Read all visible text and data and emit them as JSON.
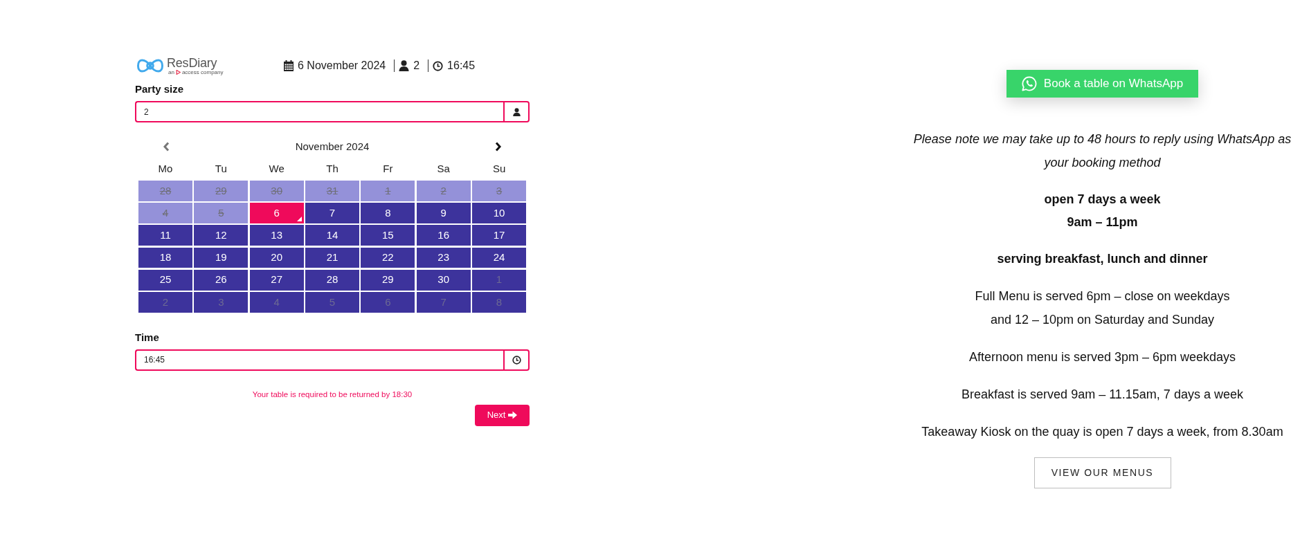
{
  "booking_widget": {
    "logo": {
      "wordmark": "ResDiary",
      "tagline_lead": "an",
      "tagline_rest": "access company"
    },
    "summary": {
      "date": "6 November 2024",
      "party_size": "2",
      "time": "16:45"
    },
    "party_size": {
      "label": "Party size",
      "value": "2"
    },
    "calendar": {
      "title": "November 2024",
      "prev": {
        "disabled": true
      },
      "next": {
        "disabled": false
      },
      "weekdays": [
        "Mo",
        "Tu",
        "We",
        "Th",
        "Fr",
        "Sa",
        "Su"
      ],
      "weeks": [
        {
          "days": [
            {
              "day": "28",
              "kind": "past",
              "selected": false
            },
            {
              "day": "29",
              "kind": "past",
              "selected": false
            },
            {
              "day": "30",
              "kind": "past",
              "selected": false
            },
            {
              "day": "31",
              "kind": "past",
              "selected": false
            },
            {
              "day": "1",
              "kind": "past",
              "selected": false
            },
            {
              "day": "2",
              "kind": "past",
              "selected": false
            },
            {
              "day": "3",
              "kind": "past",
              "selected": false
            }
          ]
        },
        {
          "days": [
            {
              "day": "4",
              "kind": "past",
              "selected": false
            },
            {
              "day": "5",
              "kind": "past",
              "selected": false
            },
            {
              "day": "6",
              "kind": "open",
              "selected": true
            },
            {
              "day": "7",
              "kind": "open",
              "selected": false
            },
            {
              "day": "8",
              "kind": "open",
              "selected": false
            },
            {
              "day": "9",
              "kind": "open",
              "selected": false
            },
            {
              "day": "10",
              "kind": "open",
              "selected": false
            }
          ]
        },
        {
          "days": [
            {
              "day": "11",
              "kind": "open",
              "selected": false
            },
            {
              "day": "12",
              "kind": "open",
              "selected": false
            },
            {
              "day": "13",
              "kind": "open",
              "selected": false
            },
            {
              "day": "14",
              "kind": "open",
              "selected": false
            },
            {
              "day": "15",
              "kind": "open",
              "selected": false
            },
            {
              "day": "16",
              "kind": "open",
              "selected": false
            },
            {
              "day": "17",
              "kind": "open",
              "selected": false
            }
          ]
        },
        {
          "days": [
            {
              "day": "18",
              "kind": "open",
              "selected": false
            },
            {
              "day": "19",
              "kind": "open",
              "selected": false
            },
            {
              "day": "20",
              "kind": "open",
              "selected": false
            },
            {
              "day": "21",
              "kind": "open",
              "selected": false
            },
            {
              "day": "22",
              "kind": "open",
              "selected": false
            },
            {
              "day": "23",
              "kind": "open",
              "selected": false
            },
            {
              "day": "24",
              "kind": "open",
              "selected": false
            }
          ]
        },
        {
          "days": [
            {
              "day": "25",
              "kind": "open",
              "selected": false
            },
            {
              "day": "26",
              "kind": "open",
              "selected": false
            },
            {
              "day": "27",
              "kind": "open",
              "selected": false
            },
            {
              "day": "28",
              "kind": "open",
              "selected": false
            },
            {
              "day": "29",
              "kind": "open",
              "selected": false
            },
            {
              "day": "30",
              "kind": "open",
              "selected": false
            },
            {
              "day": "1",
              "kind": "outside",
              "selected": false
            }
          ]
        },
        {
          "days": [
            {
              "day": "2",
              "kind": "outside",
              "selected": false
            },
            {
              "day": "3",
              "kind": "outside",
              "selected": false
            },
            {
              "day": "4",
              "kind": "outside",
              "selected": false
            },
            {
              "day": "5",
              "kind": "outside",
              "selected": false
            },
            {
              "day": "6",
              "kind": "outside",
              "selected": false
            },
            {
              "day": "7",
              "kind": "outside",
              "selected": false
            },
            {
              "day": "8",
              "kind": "outside",
              "selected": false
            }
          ]
        }
      ]
    },
    "time": {
      "label": "Time",
      "value": "16:45"
    },
    "notice": "Your table is required to be returned by 18:30",
    "next_button": {
      "label": "Next"
    }
  },
  "info_panel": {
    "whatsapp_button": {
      "label": "Book a table on WhatsApp"
    },
    "paragraphs": [
      {
        "kind": "note",
        "lines": [
          "Please note we may take up to 48 hours to reply using WhatsApp as your booking method"
        ]
      },
      {
        "kind": "highlight",
        "lines": [
          "open 7 days a week",
          "9am – 11pm"
        ]
      },
      {
        "kind": "highlight",
        "lines": [
          "serving breakfast, lunch and dinner"
        ]
      },
      {
        "kind": "plain",
        "lines": [
          "Full Menu is served 6pm – close on weekdays",
          "and 12 – 10pm on Saturday and Sunday"
        ]
      },
      {
        "kind": "plain",
        "lines": [
          "Afternoon menu is served 3pm – 6pm weekdays"
        ]
      },
      {
        "kind": "plain",
        "lines": [
          "Breakfast is served 9am – 11.15am, 7 days a week"
        ]
      },
      {
        "kind": "plain",
        "lines": [
          "Takeaway Kiosk on the quay is open 7 days a week, from 8.30am"
        ]
      }
    ],
    "menus_button": {
      "label": "VIEW OUR MENUS"
    }
  }
}
